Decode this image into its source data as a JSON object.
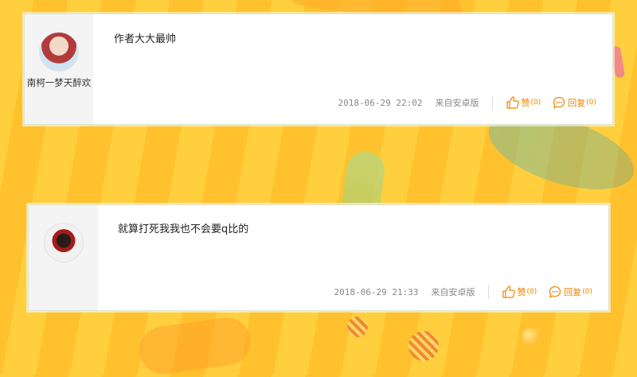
{
  "comments": [
    {
      "nickname": "南柯一梦天醉欢",
      "text": "作者大大最帅",
      "time": "2018-06-29 22:02",
      "source": "来自安卓版",
      "like_label": "赞",
      "like_count": "(0)",
      "reply_label": "回复",
      "reply_count": "(0)"
    },
    {
      "nickname": "",
      "text": "就算打死我我也不会要q比的",
      "time": "2018-06-29 21:33",
      "source": "来自安卓版",
      "like_label": "赞",
      "like_count": "(0)",
      "reply_label": "回复",
      "reply_count": "(0)"
    }
  ],
  "colors": {
    "accent": "#f08300",
    "background_yellow": "#ffcf3e",
    "card_border": "#d8e6cf"
  },
  "icons": {
    "like": "thumbs-up-icon",
    "reply": "speech-bubble-icon"
  }
}
